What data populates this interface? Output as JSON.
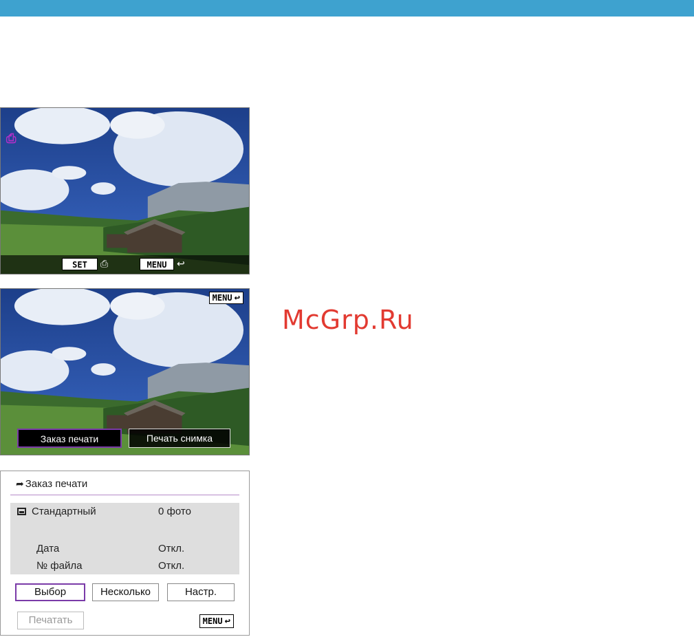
{
  "watermark": "McGrp.Ru",
  "screen1": {
    "set_label": "SET",
    "menu_label": "MENU",
    "print_icon": "print-order-icon"
  },
  "screen2": {
    "menu_label": "MENU",
    "buttons": [
      {
        "label": "Заказ печати",
        "selected": true
      },
      {
        "label": "Печать снимка",
        "selected": false
      }
    ]
  },
  "panel3": {
    "title": "Заказ печати",
    "rows": [
      {
        "label": "Стандартный",
        "value": "0 фото"
      },
      {
        "label": "Дата",
        "value": "Откл."
      },
      {
        "label": "№ файла",
        "value": "Откл."
      }
    ],
    "buttons": {
      "select": "Выбор",
      "multiple": "Несколько",
      "settings": "Настр.",
      "print": "Печатать"
    },
    "menu_label": "MENU"
  },
  "colors": {
    "top_bar": "#3ea2cf",
    "accent_purple": "#7a3aa8",
    "watermark_red": "#e23a31"
  }
}
